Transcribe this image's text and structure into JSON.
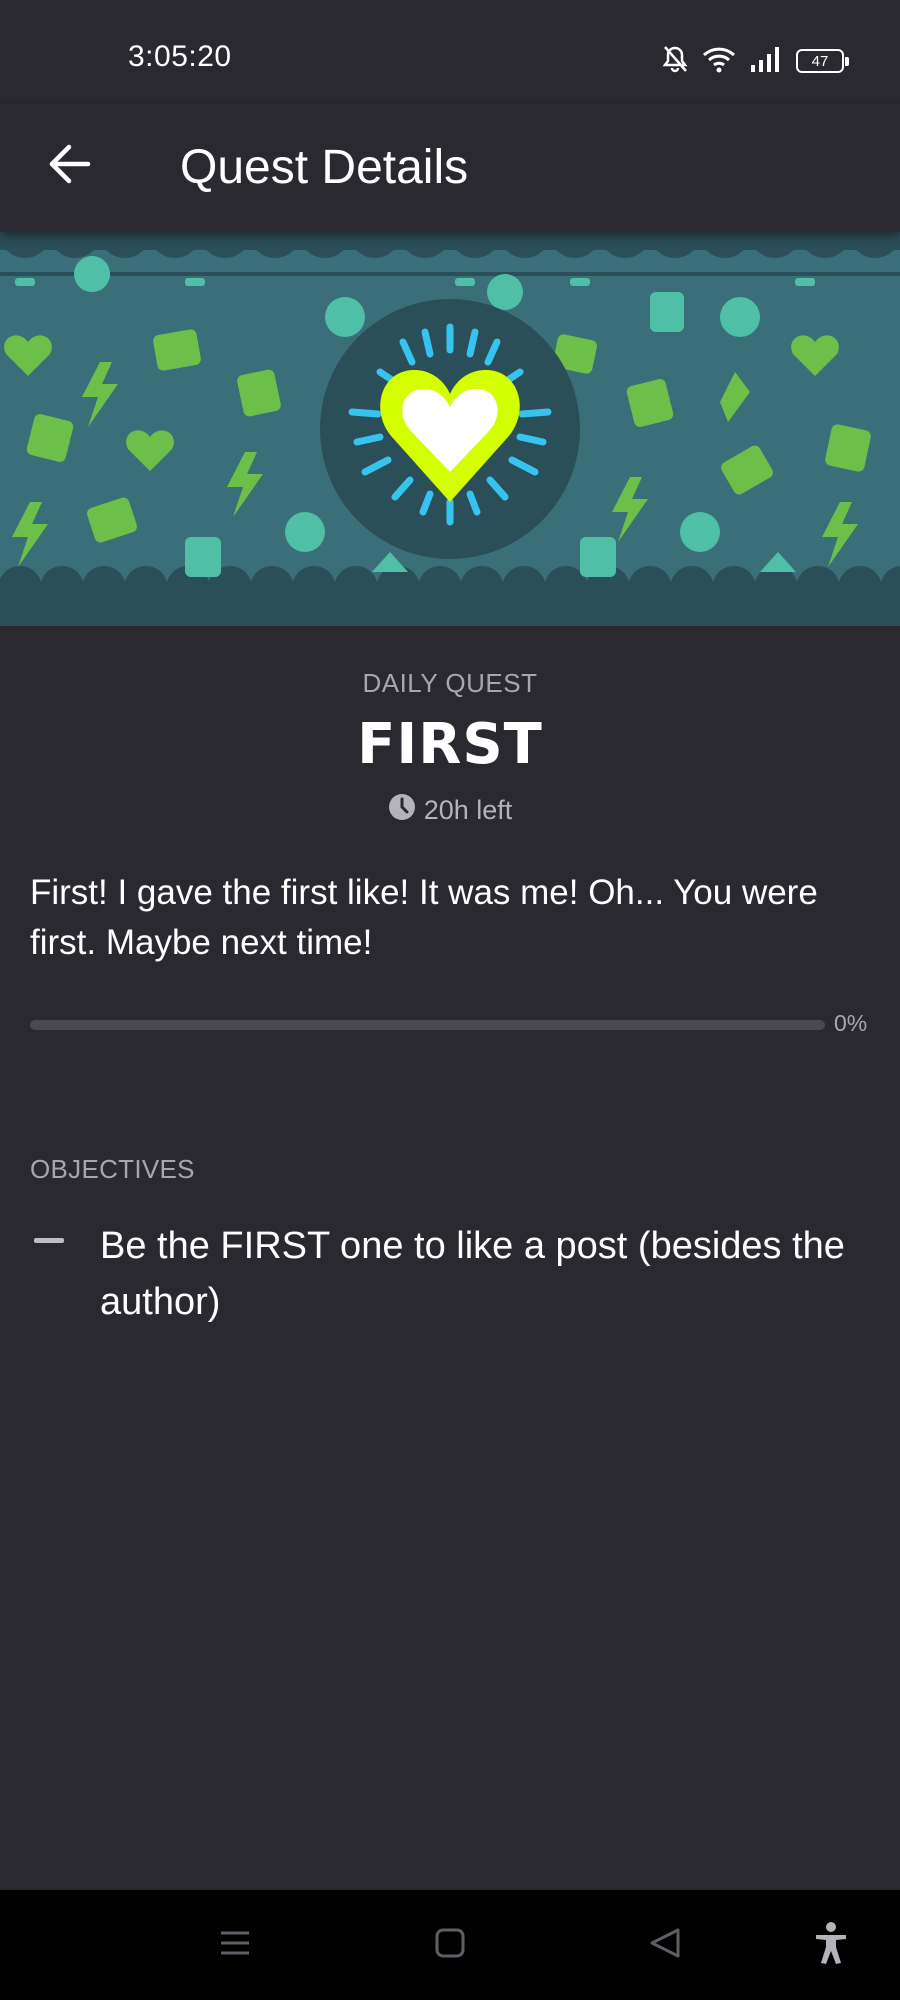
{
  "status_bar": {
    "time": "3:05:20",
    "battery_level": "47",
    "icons": [
      "bell-muted-icon",
      "wifi-icon",
      "signal-icon",
      "battery-icon"
    ]
  },
  "header": {
    "title": "Quest Details",
    "back_icon": "arrow-left-icon"
  },
  "quest": {
    "type_label": "DAILY QUEST",
    "name": "FIRST",
    "time_left": "20h left",
    "description": "First! I gave the first like! It was me! Oh... You were first. Maybe next time!",
    "progress": 0,
    "progress_label": "0%",
    "banner_icon": "glowing-heart-icon"
  },
  "objectives": {
    "heading": "OBJECTIVES",
    "items": [
      {
        "text": "Be the FIRST one to like a post (besides the author)"
      }
    ]
  },
  "nav_bar": {
    "icons": [
      "menu-icon",
      "home-icon",
      "back-icon",
      "accessibility-icon"
    ]
  },
  "colors": {
    "background": "#2a2930",
    "banner_bg": "#3a6f7a",
    "banner_dark": "#2b4f58",
    "heart_yellow": "#d4ff00",
    "ray_blue": "#37c3f0",
    "sticker_green": "#6cc04a",
    "sticker_teal": "#4fc0a6",
    "muted_text": "#a7a6ad"
  }
}
